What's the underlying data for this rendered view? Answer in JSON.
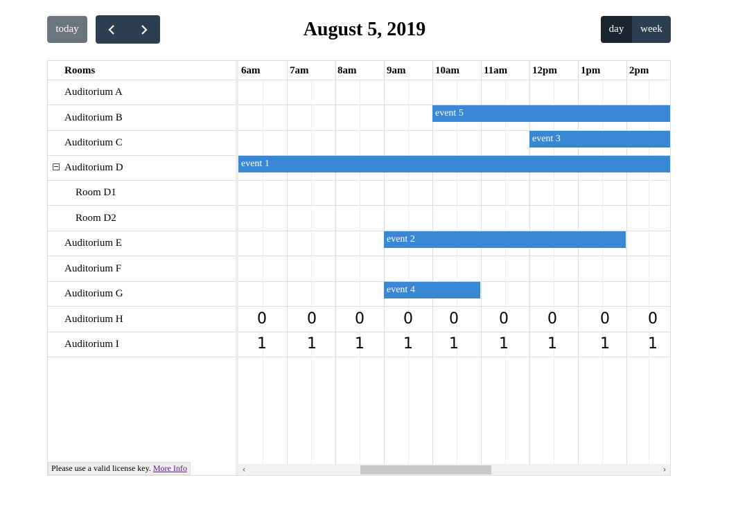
{
  "toolbar": {
    "today_label": "today",
    "prev_icon": "chevron-left-icon",
    "next_icon": "chevron-right-icon",
    "title": "August 5, 2019",
    "views": [
      {
        "id": "day",
        "label": "day",
        "active": true
      },
      {
        "id": "week",
        "label": "week",
        "active": false
      }
    ]
  },
  "resources": {
    "header": "Rooms",
    "rows": [
      {
        "label": "Auditorium A",
        "level": 0
      },
      {
        "label": "Auditorium B",
        "level": 0
      },
      {
        "label": "Auditorium C",
        "level": 0
      },
      {
        "label": "Auditorium D",
        "level": 0,
        "expander": "collapse-icon"
      },
      {
        "label": "Room D1",
        "level": 1
      },
      {
        "label": "Room D2",
        "level": 1
      },
      {
        "label": "Auditorium E",
        "level": 0
      },
      {
        "label": "Auditorium F",
        "level": 0
      },
      {
        "label": "Auditorium G",
        "level": 0
      },
      {
        "label": "Auditorium H",
        "level": 0
      },
      {
        "label": "Auditorium I",
        "level": 0
      }
    ]
  },
  "timeline": {
    "slots": [
      "6am",
      "7am",
      "8am",
      "9am",
      "10am",
      "11am",
      "12pm",
      "1pm",
      "2pm"
    ]
  },
  "events": [
    {
      "title": "event 5",
      "row": 1,
      "start": "10am",
      "end": "past 2pm"
    },
    {
      "title": "event 3",
      "row": 2,
      "start": "12pm",
      "end": "past 2pm"
    },
    {
      "title": "event 1",
      "row": 3,
      "start": "6am",
      "end": "past 2pm"
    },
    {
      "title": "event 2",
      "row": 6,
      "start": "9am",
      "end": "2pm"
    },
    {
      "title": "event 4",
      "row": 8,
      "start": "9am",
      "end": "11am"
    }
  ],
  "cell_values": {
    "Auditorium H": [
      "0",
      "0",
      "0",
      "0",
      "0",
      "0",
      "0",
      "0",
      "0"
    ],
    "Auditorium I": [
      "1",
      "1",
      "1",
      "1",
      "1",
      "1",
      "1",
      "1",
      "1"
    ]
  },
  "scrollbar": {
    "left_icon": "‹",
    "right_icon": "›"
  },
  "license": {
    "text": "Please use a valid license key.",
    "link": "More Info"
  },
  "colors": {
    "event": "#3a87d6",
    "nav": "#2c3e50",
    "today": "#6c757d"
  }
}
